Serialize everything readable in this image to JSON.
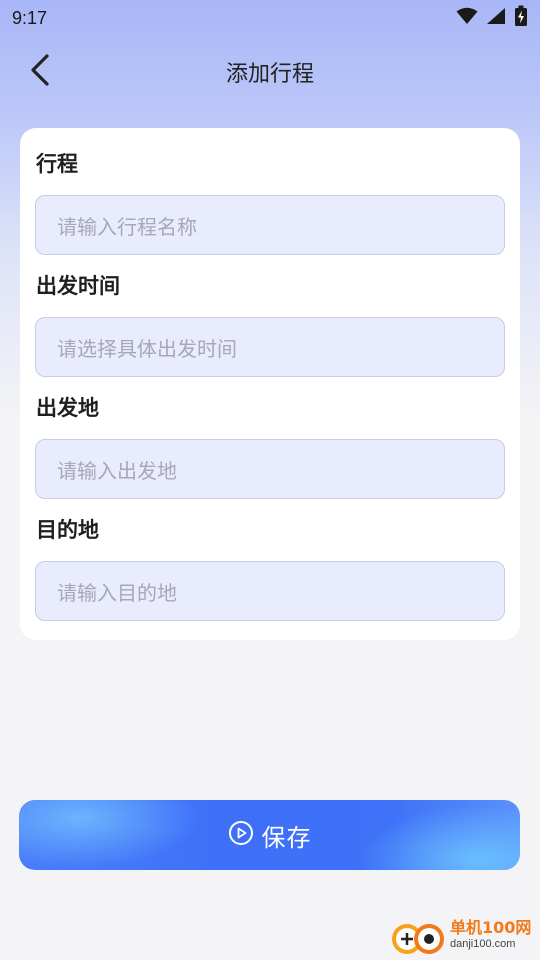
{
  "status_bar": {
    "time": "9:17",
    "icons": [
      "wifi-icon",
      "signal-icon",
      "battery-charging-icon"
    ]
  },
  "header": {
    "title": "添加行程",
    "back_icon": "chevron-left-icon"
  },
  "form": {
    "fields": [
      {
        "label": "行程",
        "placeholder": "请输入行程名称"
      },
      {
        "label": "出发时间",
        "placeholder": "请选择具体出发时间"
      },
      {
        "label": "出发地",
        "placeholder": "请输入出发地"
      },
      {
        "label": "目的地",
        "placeholder": "请输入目的地"
      }
    ]
  },
  "save_button": {
    "label": "保存",
    "icon": "play-circle-icon"
  },
  "watermark": {
    "name": "单机100网",
    "url": "danji100.com"
  },
  "colors": {
    "accent": "#3d6ff8",
    "input_bg": "#e9ebff",
    "watermark_orange": "#f07a1c"
  }
}
